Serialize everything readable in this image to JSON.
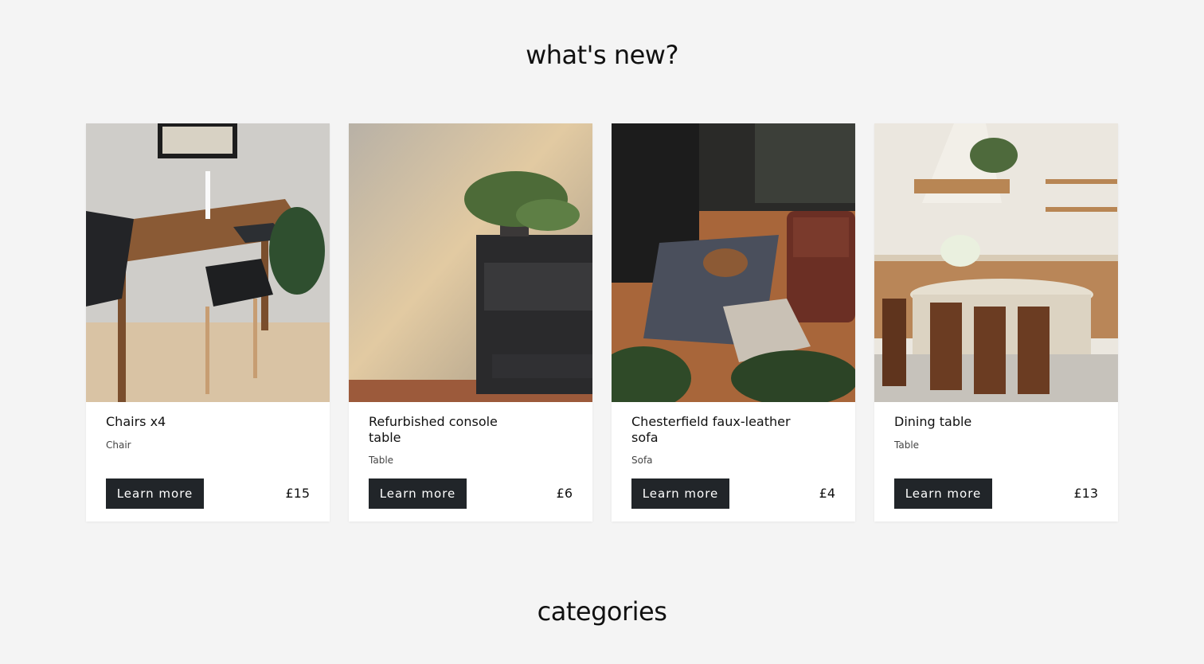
{
  "sections": {
    "whats_new_title": "what's new?",
    "categories_title": "categories"
  },
  "products": [
    {
      "name": "Chairs x4",
      "category": "Chair",
      "price": "£15",
      "button": "Learn more",
      "image": "dining-chairs-photo"
    },
    {
      "name": "Refurbished console table",
      "category": "Table",
      "price": "£6",
      "button": "Learn more",
      "image": "console-table-photo"
    },
    {
      "name": "Chesterfield faux-leather sofa",
      "category": "Sofa",
      "price": "£4",
      "button": "Learn more",
      "image": "sofa-living-room-photo"
    },
    {
      "name": "Dining table",
      "category": "Table",
      "price": "£13",
      "button": "Learn more",
      "image": "kitchen-dining-photo"
    }
  ]
}
